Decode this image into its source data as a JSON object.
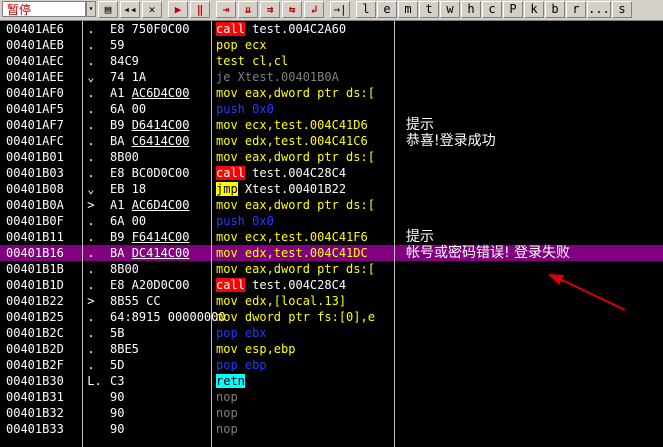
{
  "toolbar": {
    "status": "暂停",
    "buttons": [
      "◂◂",
      "✕",
      "▶",
      "‖",
      "⇥",
      "⇊",
      "⇉",
      "⇆",
      "↲",
      "→|"
    ],
    "letters": [
      "l",
      "e",
      "m",
      "t",
      "w",
      "h",
      "c",
      "P",
      "k",
      "b",
      "r",
      "...",
      "s"
    ]
  },
  "rows": [
    {
      "addr": "00401AE6",
      "mark": " .",
      "hex": "E8 750F0C00",
      "mnem": "call",
      "ops": " test.004C2A60",
      "style": "call"
    },
    {
      "addr": "00401AEB",
      "mark": " .",
      "hex": "59",
      "mnem": "pop ecx",
      "ops": "",
      "style": "yellow"
    },
    {
      "addr": "00401AEC",
      "mark": " .",
      "hex": "84C9",
      "mnem": "test cl,cl",
      "ops": "",
      "style": "yellow"
    },
    {
      "addr": "00401AEE",
      "mark": " ⌄",
      "hex": "74 1A",
      "mnem": "je Xtest.00401B0A",
      "ops": "",
      "style": "gray"
    },
    {
      "addr": "00401AF0",
      "mark": " .",
      "hex": "A1 AC6D4C00",
      "hexu": true,
      "mnem": "mov eax,dword ptr ds:[",
      "ops": "",
      "style": "yellow"
    },
    {
      "addr": "00401AF5",
      "mark": " .",
      "hex": "6A 00",
      "mnem": "push 0x0",
      "ops": "",
      "style": "push"
    },
    {
      "addr": "00401AF7",
      "mark": " .",
      "hex": "B9 D6414C00",
      "hexu": true,
      "mnem": "mov ecx,test.004C41D6",
      "ops": "",
      "style": "yellow",
      "comment": "提示"
    },
    {
      "addr": "00401AFC",
      "mark": " .",
      "hex": "BA C6414C00",
      "hexu": true,
      "mnem": "mov edx,test.004C41C6",
      "ops": "",
      "style": "yellow",
      "comment": "恭喜!登录成功"
    },
    {
      "addr": "00401B01",
      "mark": " .",
      "hex": "8B00",
      "mnem": "mov eax,dword ptr ds:[",
      "ops": "",
      "style": "yellow"
    },
    {
      "addr": "00401B03",
      "mark": " .",
      "hex": "E8 BC0D0C00",
      "mnem": "call",
      "ops": " test.004C28C4",
      "style": "call"
    },
    {
      "addr": "00401B08",
      "mark": " ⌄",
      "hex": "EB 18",
      "mnem": "jmp",
      "ops": " Xtest.00401B22",
      "style": "jmp"
    },
    {
      "addr": "00401B0A",
      "mark": " >",
      "hex": "A1 AC6D4C00",
      "hexu": true,
      "mnem": "mov eax,dword ptr ds:[",
      "ops": "",
      "style": "yellow"
    },
    {
      "addr": "00401B0F",
      "mark": " .",
      "hex": "6A 00",
      "mnem": "push 0x0",
      "ops": "",
      "style": "push"
    },
    {
      "addr": "00401B11",
      "mark": " .",
      "hex": "B9 F6414C00",
      "hexu": true,
      "mnem": "mov ecx,test.004C41F6",
      "ops": "",
      "style": "yellow",
      "comment": "提示"
    },
    {
      "addr": "00401B16",
      "mark": " .",
      "hex": "BA DC414C00",
      "hexu": true,
      "mnem": "mov edx,test.004C41DC",
      "ops": "",
      "style": "yellow",
      "comment": "帐号或密码错误! 登录失败",
      "selected": true
    },
    {
      "addr": "00401B1B",
      "mark": " .",
      "hex": "8B00",
      "mnem": "mov eax,dword ptr ds:[",
      "ops": "",
      "style": "yellow"
    },
    {
      "addr": "00401B1D",
      "mark": " .",
      "hex": "E8 A20D0C00",
      "mnem": "call",
      "ops": " test.004C28C4",
      "style": "call"
    },
    {
      "addr": "00401B22",
      "mark": " >",
      "hex": "8B55 CC",
      "mnem": "mov edx,[local.13]",
      "ops": "",
      "style": "yellow"
    },
    {
      "addr": "00401B25",
      "mark": " .",
      "hex": "64:8915 00000000",
      "mnem": "mov dword ptr fs:[0],e",
      "ops": "",
      "style": "yellow"
    },
    {
      "addr": "00401B2C",
      "mark": " .",
      "hex": "5B",
      "mnem": "pop ebx",
      "ops": "",
      "style": "push"
    },
    {
      "addr": "00401B2D",
      "mark": " .",
      "hex": "8BE5",
      "mnem": "mov esp,ebp",
      "ops": "",
      "style": "yellow"
    },
    {
      "addr": "00401B2F",
      "mark": " .",
      "hex": "5D",
      "mnem": "pop ebp",
      "ops": "",
      "style": "push"
    },
    {
      "addr": "00401B30",
      "mark": " L.",
      "hex": "C3",
      "mnem": "retn",
      "ops": "",
      "style": "retn"
    },
    {
      "addr": "00401B31",
      "mark": "",
      "hex": "90",
      "mnem": "nop",
      "ops": "",
      "style": "gray"
    },
    {
      "addr": "00401B32",
      "mark": "",
      "hex": "90",
      "mnem": "nop",
      "ops": "",
      "style": "gray"
    },
    {
      "addr": "00401B33",
      "mark": "",
      "hex": "90",
      "mnem": "nop",
      "ops": "",
      "style": "gray"
    }
  ],
  "colors": {
    "selected": "#800080",
    "call": "#ff0000",
    "jmp": "#ffff00",
    "retn": "#00ffff",
    "arrow": "#e00000"
  }
}
